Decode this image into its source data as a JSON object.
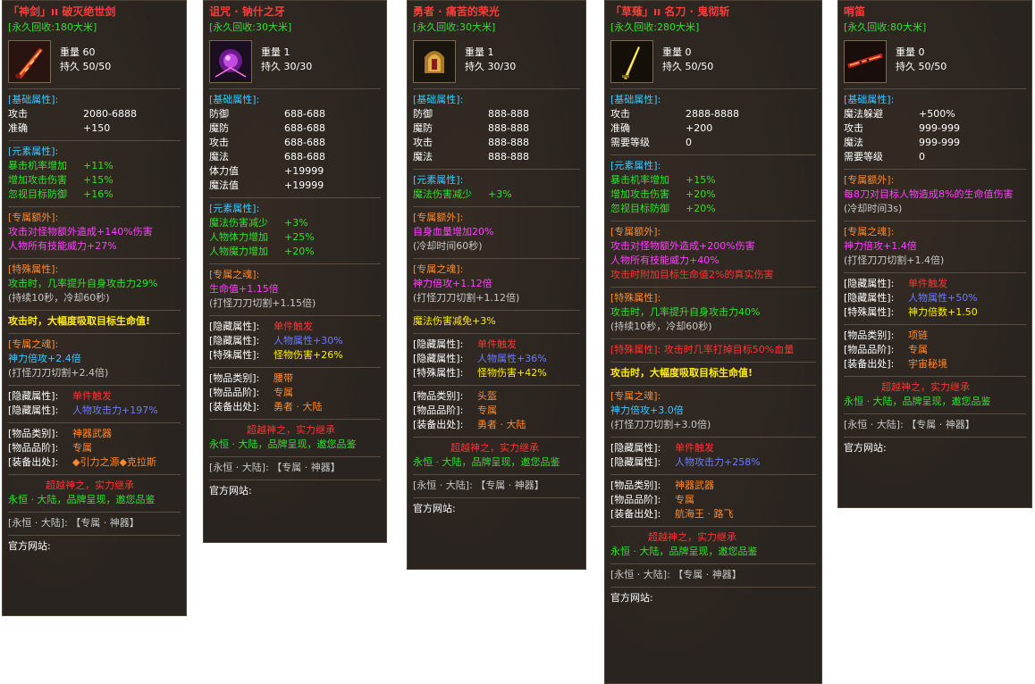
{
  "panels": [
    {
      "title": "「神剑」ıı 破灭绝世剑",
      "recycle": "[永久回收:180大米]",
      "weight": "重量 60",
      "durability": "持久 50/50",
      "sec_basic": "[基础属性]:",
      "basic": [
        [
          "攻击",
          "2080-6888"
        ],
        [
          "准确",
          "+150"
        ]
      ],
      "sec_element": "[元素属性]:",
      "element": [
        [
          "暴击机率增加",
          "+11%"
        ],
        [
          "增加攻击伤害",
          "+15%"
        ],
        [
          "忽视目标防御",
          "+16%"
        ]
      ],
      "sec_extra": "[专属额外]:",
      "extra": [
        "攻击对怪物额外造成+140%伤害",
        "人物所有技能威力+27%"
      ],
      "sec_special": "[特殊属性]:",
      "special": [
        "攻击时，几率提升自身攻击力29%",
        "(持续10秒，冷却60秒)"
      ],
      "drain": "攻击时，大幅度吸取目标生命值!",
      "sec_soul": "[专属之魂]:",
      "soul": [
        "神力倍攻+2.4倍",
        "(打怪刀刀切割+2.4倍)"
      ],
      "hidden": [
        [
          "[隐藏属性]:",
          "单件触发"
        ],
        [
          "[隐藏属性]:",
          "人物攻击力+197%"
        ]
      ],
      "info": [
        [
          "[物品类别]:",
          "神器武器"
        ],
        [
          "[物品品阶]:",
          "专属"
        ],
        [
          "[装备出处]:",
          "◆引力之源◆克拉斯"
        ]
      ],
      "slogan1": "超越神之，实力继承",
      "slogan2": "永恒 · 大陆，品牌呈现，邀您品鉴",
      "footer": "[永恒 · 大陆]: 【专属 · 神器】",
      "site": "官方网站:"
    },
    {
      "title": "诅咒 · 钠什之牙",
      "recycle": "[永久回收:30大米]",
      "weight": "重量 1",
      "durability": "持久 30/30",
      "sec_basic": "[基础属性]:",
      "basic": [
        [
          "防御",
          "688-688"
        ],
        [
          "魔防",
          "688-688"
        ],
        [
          "攻击",
          "688-688"
        ],
        [
          "魔法",
          "688-688"
        ],
        [
          "体力值",
          "+19999"
        ],
        [
          "魔法值",
          "+19999"
        ]
      ],
      "sec_element": "[元素属性]:",
      "element": [
        [
          "魔法伤害减少",
          "+3%"
        ],
        [
          "人物体力增加",
          "+25%"
        ],
        [
          "人物魔力增加",
          "+20%"
        ]
      ],
      "sec_soul": "[专属之魂]:",
      "soul": [
        "生命值+1.15倍",
        "(打怪刀刀切割+1.15倍)"
      ],
      "hidden": [
        [
          "[隐藏属性]:",
          "单件触发"
        ],
        [
          "[隐藏属性]:",
          "人物属性+30%"
        ],
        [
          "[特殊属性]:",
          "怪物伤害+26%"
        ]
      ],
      "info": [
        [
          "[物品类别]:",
          "腰带"
        ],
        [
          "[物品品阶]:",
          "专属"
        ],
        [
          "[装备出处]:",
          "勇者 · 大陆"
        ]
      ],
      "slogan1": "超越神之，实力继承",
      "slogan2": "永恒 · 大陆，品牌呈现，邀您品鉴",
      "footer": "[永恒 · 大陆]: 【专属 · 神器】",
      "site": "官方网站:"
    },
    {
      "title": "勇者 · 痛苦的荣光",
      "recycle": "[永久回收:30大米]",
      "weight": "重量 1",
      "durability": "持久 30/30",
      "sec_basic": "[基础属性]:",
      "basic": [
        [
          "防御",
          "888-888"
        ],
        [
          "魔防",
          "888-888"
        ],
        [
          "攻击",
          "888-888"
        ],
        [
          "魔法",
          "888-888"
        ]
      ],
      "sec_element": "[元素属性]:",
      "element": [
        [
          "魔法伤害减少",
          "+3%"
        ]
      ],
      "sec_extra": "[专属额外]:",
      "extra": [
        "自身血量增加20%",
        "(冷却时间60秒)"
      ],
      "sec_soul": "[专属之魂]:",
      "soul": [
        "神力倍攻+1.12倍",
        "(打怪刀刀切割+1.12倍)"
      ],
      "magic_reduce": "魔法伤害减免+3%",
      "hidden": [
        [
          "[隐藏属性]:",
          "单件触发"
        ],
        [
          "[隐藏属性]:",
          "人物属性+36%"
        ],
        [
          "[特殊属性]:",
          "怪物伤害+42%"
        ]
      ],
      "info": [
        [
          "[物品类别]:",
          "头盔"
        ],
        [
          "[物品品阶]:",
          "专属"
        ],
        [
          "[装备出处]:",
          "勇者 · 大陆"
        ]
      ],
      "slogan1": "超越神之，实力继承",
      "slogan2": "永恒 · 大陆，品牌呈现，邀您品鉴",
      "footer": "[永恒 · 大陆]: 【专属 · 神器】",
      "site": "官方网站:"
    },
    {
      "title": "「草薙」ıı 名刀 · 鬼彻斩",
      "recycle": "[永久回收:280大米]",
      "weight": "重量 0",
      "durability": "持久 50/50",
      "sec_basic": "[基础属性]:",
      "basic": [
        [
          "攻击",
          "2888-8888"
        ],
        [
          "准确",
          "+200"
        ],
        [
          "需要等级",
          "0"
        ]
      ],
      "sec_element": "[元素属性]:",
      "element": [
        [
          "暴击机率增加",
          "+15%"
        ],
        [
          "增加攻击伤害",
          "+20%"
        ],
        [
          "忽视目标防御",
          "+20%"
        ]
      ],
      "sec_extra": "[专属额外]:",
      "extra": [
        "攻击对怪物额外造成+200%伤害",
        "人物所有技能威力+40%",
        "攻击时附加目标生命值2%的真实伤害"
      ],
      "sec_special": "[特殊属性]:",
      "special": [
        "攻击时，几率提升自身攻击力40%",
        "(持续10秒，冷却60秒)"
      ],
      "special2": "[特殊属性]: 攻击时几率打掉目标50%血量",
      "drain": "攻击时，大幅度吸取目标生命值!",
      "sec_soul": "[专属之魂]:",
      "soul": [
        "神力倍攻+3.0倍",
        "(打怪刀刀切割+3.0倍)"
      ],
      "hidden": [
        [
          "[隐藏属性]:",
          "单件触发"
        ],
        [
          "[隐藏属性]:",
          "人物攻击力+258%"
        ]
      ],
      "info": [
        [
          "[物品类别]:",
          "神器武器"
        ],
        [
          "[物品品阶]:",
          "专属"
        ],
        [
          "[装备出处]:",
          "航海王 · 路飞"
        ]
      ],
      "slogan1": "超越神之，实力继承",
      "slogan2": "永恒 · 大陆，品牌呈现，邀您品鉴",
      "footer": "[永恒 · 大陆]: 【专属 · 神器】",
      "site": "官方网站:"
    },
    {
      "title": "哨笛",
      "recycle": "[永久回收:80大米]",
      "weight": "重量 0",
      "durability": "持久 50/50",
      "sec_basic": "[基础属性]:",
      "basic": [
        [
          "魔法躲避",
          "+500%"
        ],
        [
          "攻击",
          "999-999"
        ],
        [
          "魔法",
          "999-999"
        ],
        [
          "需要等级",
          "0"
        ]
      ],
      "sec_extra": "[专属额外]:",
      "extra": [
        "每8刀对目标人物造成8%的生命值伤害",
        "(冷却时间3s)"
      ],
      "sec_soul": "[专属之魂]:",
      "soul": [
        "神力倍攻+1.4倍",
        "(打怪刀刀切割+1.4倍)"
      ],
      "hidden": [
        [
          "[隐藏属性]:",
          "单件触发"
        ],
        [
          "[隐藏属性]:",
          "人物属性+50%"
        ],
        [
          "[特殊属性]:",
          "神力倍数+1.50"
        ]
      ],
      "info": [
        [
          "[物品类别]:",
          "项链"
        ],
        [
          "[物品品阶]:",
          "专属"
        ],
        [
          "[装备出处]:",
          "宇宙秘境"
        ]
      ],
      "slogan1": "超越神之，实力继承",
      "slogan2": "永恒 · 大陆，品牌呈现，邀您品鉴",
      "footer": "[永恒 · 大陆]: 【专属 · 神器】",
      "site": "官方网站:"
    }
  ],
  "colors": {
    "panel_bg": "#2a2420",
    "title": "#ff3b3b",
    "green": "#2ee12e",
    "cyan": "#3fc8ff",
    "orange": "#ff8a2a",
    "magenta": "#ff40ff",
    "yellow": "#ffee00",
    "blue": "#6b7bff"
  },
  "icons": [
    "flame-sword-icon",
    "dark-orb-icon",
    "golden-helmet-icon",
    "golden-blade-icon",
    "flute-icon"
  ]
}
